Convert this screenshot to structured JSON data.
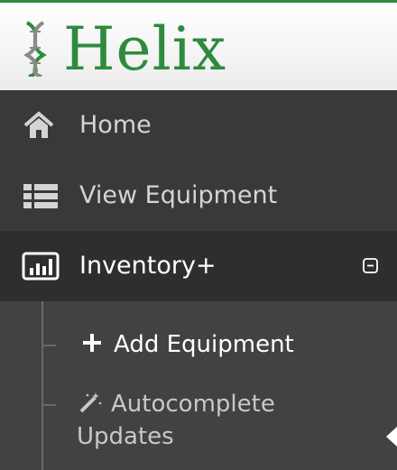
{
  "brand": {
    "name": "Helix",
    "color": "#2e8b3e"
  },
  "nav": {
    "items": [
      {
        "label": "Home",
        "icon": "home-icon"
      },
      {
        "label": "View Equipment",
        "icon": "list-icon"
      },
      {
        "label": "Inventory+",
        "icon": "bar-chart-icon",
        "expanded": true,
        "toggle_icon": "collapse-minus-icon"
      }
    ],
    "submenu": [
      {
        "label": "Add Equipment",
        "icon": "plus-icon",
        "active": true
      },
      {
        "label": "Autocomplete Updates",
        "icon": "magic-wand-icon"
      }
    ]
  }
}
